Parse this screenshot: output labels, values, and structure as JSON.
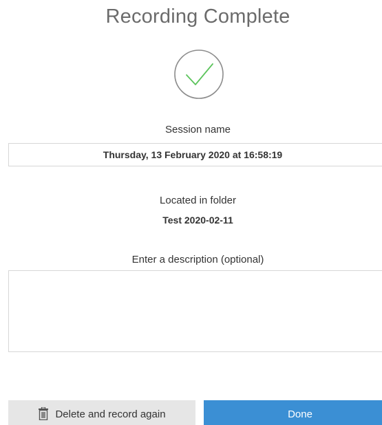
{
  "dialog": {
    "title": "Recording Complete",
    "success_icon": "checkmark-circle-icon",
    "accent_color": "#5cc45c"
  },
  "session": {
    "label": "Session name",
    "value": "Thursday, 13 February 2020 at 16:58:19"
  },
  "folder": {
    "label": "Located in folder",
    "value": "Test 2020-02-11"
  },
  "description": {
    "label": "Enter a description (optional)",
    "value": ""
  },
  "actions": {
    "delete_label": "Delete and record again",
    "delete_icon": "trash-icon",
    "done_label": "Done",
    "done_color": "#3b8fd4"
  }
}
